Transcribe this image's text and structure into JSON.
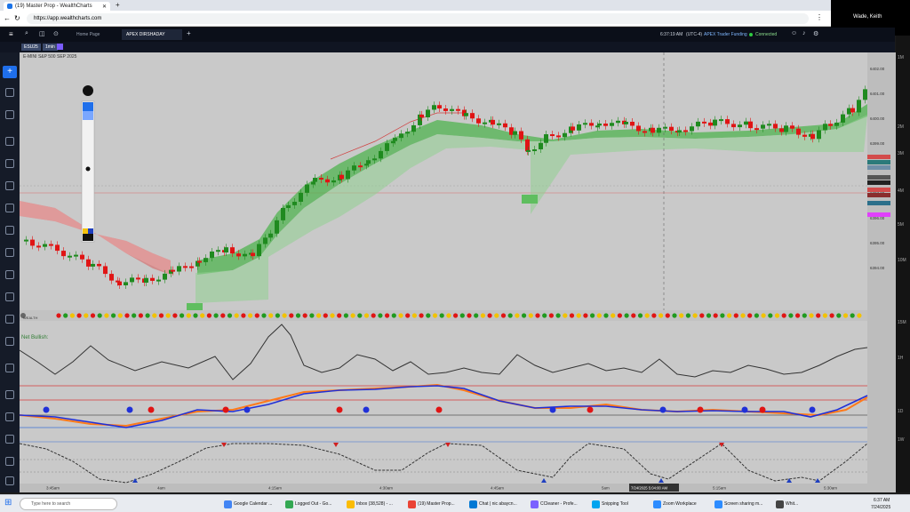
{
  "browser": {
    "tab_title": "(19) Master Prop - WealthCharts",
    "url": "https://app.wealthcharts.com"
  },
  "webcam": {
    "name": "Wade, Keith"
  },
  "app": {
    "tabs": [
      {
        "label": "Home Page"
      },
      {
        "label": "APEX DIRSHADAY"
      }
    ],
    "clock": "6:37:19 AM",
    "timezone": "(UTC-4)",
    "account": "APEX Trader Funding",
    "connection": "Connected"
  },
  "symbol_bar": {
    "symbol": "ESU25",
    "interval": "1min",
    "instrument": "E-MINI S&P 500 SEP 2025"
  },
  "indicators": {
    "wealth_label": "WEALTH",
    "bullish_text": "Net Bullish:"
  },
  "crosshair_label": "7/24/2025 5:04:00 AM",
  "time_ticks": [
    "3:45am",
    "4am",
    "4:15am",
    "4:30am",
    "4:45am",
    "5am",
    "5:15am",
    "5:30am"
  ],
  "price_ticks": [
    "6402.00",
    "6401.00",
    "6400.00",
    "6399.00",
    "6398.00",
    "6397.00",
    "6396.00",
    "6395.00",
    "6394.00"
  ],
  "right_scale": [
    "1M",
    "2M",
    "3M",
    "4M",
    "5M",
    "10M",
    "15M",
    "1H",
    "1D",
    "1W"
  ],
  "taskbar": {
    "search_placeholder": "Type here to search",
    "items": [
      "Google Calendar ...",
      "Logged Out - Go...",
      "Inbox (38,528) - ...",
      "(19) Master Prop...",
      "Chat | nic abaycn...",
      "CCleaner - Profe...",
      "Snipping Tool",
      "Zoom Workplace",
      "Screen sharing m...",
      "Whit..."
    ],
    "time": "6:37 AM",
    "date": "7/24/2025"
  },
  "colors": {
    "bull": "#1f8a1f",
    "bear": "#e01414",
    "band_green": "#5fbe5f",
    "band_red": "#d85a5a",
    "chart_bg": "#c9c9c9",
    "app_bg": "#0b0f19"
  }
}
